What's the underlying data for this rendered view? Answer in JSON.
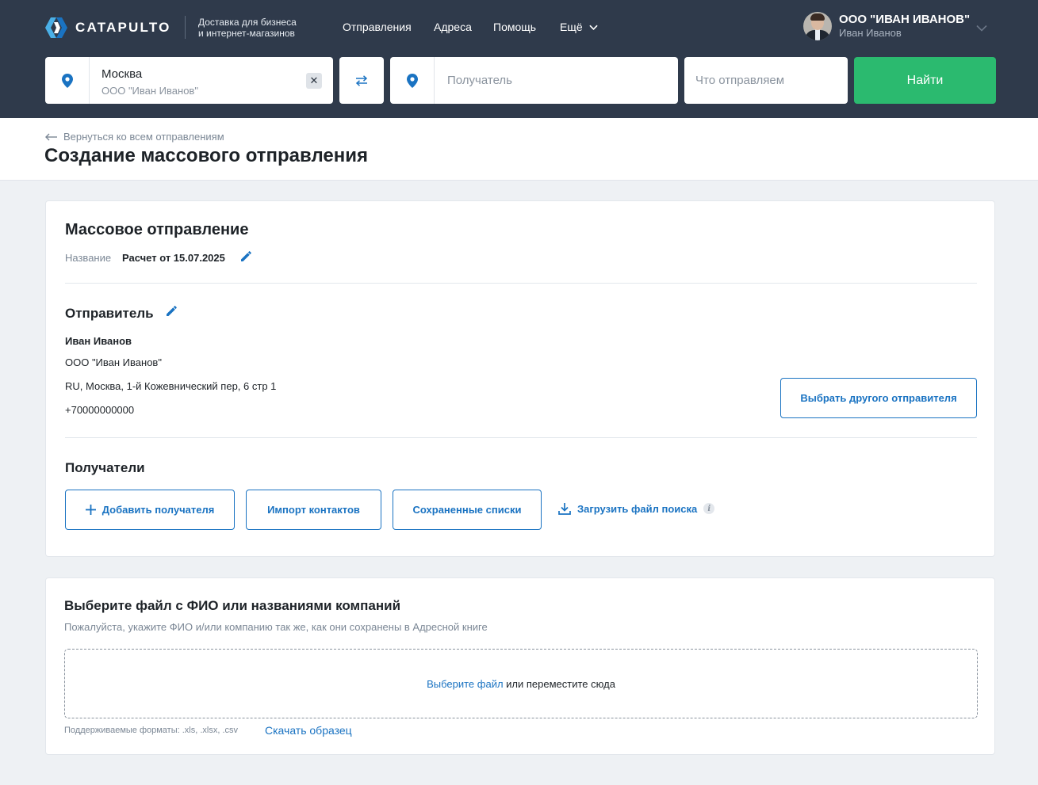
{
  "header": {
    "brand": "CATAPULTO",
    "tagline_line1": "Доставка для бизнеса",
    "tagline_line2": "и интернет-магазинов",
    "nav": [
      "Отправления",
      "Адреса",
      "Помощь",
      "Ещё"
    ],
    "profile": {
      "company": "ООО \"ИВАН ИВАНОВ\"",
      "user": "Иван Иванов"
    },
    "search": {
      "from_city": "Москва",
      "from_sub": "ООО \"Иван Иванов\"",
      "clear_symbol": "✕",
      "recipient_placeholder": "Получатель",
      "what_placeholder": "Что отправляем",
      "find_label": "Найти"
    },
    "colors": {
      "bg": "#2f3a4b",
      "accent": "#1a73c2",
      "find": "#2bba6f"
    }
  },
  "page": {
    "back_label": "Вернуться ко всем отправлениям",
    "title": "Создание массового отправления"
  },
  "mass": {
    "heading": "Массовое отправление",
    "name_label": "Название",
    "name_value": "Расчет от 15.07.2025",
    "sender_heading": "Отправитель",
    "sender": {
      "name": "Иван Иванов",
      "company": "ООО \"Иван Иванов\"",
      "address": "RU, Москва, 1-й Кожевнический пер, 6 стр 1",
      "phone": "+70000000000"
    },
    "choose_sender": "Выбрать другого отправителя",
    "recipients_heading": "Получатели",
    "buttons": {
      "add": "Добавить получателя",
      "import": "Импорт контактов",
      "saved": "Сохраненные списки",
      "upload": "Загрузить файл поиска",
      "info": "i"
    }
  },
  "upload": {
    "heading": "Выберите файл с ФИО или названиями компаний",
    "subtitle": "Пожалуйста, укажите ФИО и/или компанию так же, как они сохранены в Адресной книге",
    "choose_file": "Выберите файл",
    "or_drop": " или переместите сюда",
    "formats": "Поддерживаемые форматы: .xls, .xlsx, .csv",
    "sample": "Скачать образец"
  }
}
